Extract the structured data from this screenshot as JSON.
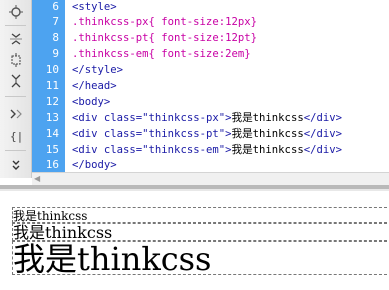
{
  "toolbar": {
    "icons": [
      "pin-icon",
      "expand-icon",
      "collapse-icon",
      "select-icon",
      "format-icon",
      "brace-icon",
      "more-icon"
    ]
  },
  "editor": {
    "lines": [
      {
        "num": "6",
        "parts": [
          {
            "t": "tag",
            "v": "<style>"
          }
        ]
      },
      {
        "num": "7",
        "parts": [
          {
            "t": "css",
            "v": ".thinkcss-px{ font-size:12px}"
          }
        ]
      },
      {
        "num": "8",
        "parts": [
          {
            "t": "css",
            "v": ".thinkcss-pt{ font-size:12pt}"
          }
        ]
      },
      {
        "num": "9",
        "parts": [
          {
            "t": "css",
            "v": ".thinkcss-em{ font-size:2em}"
          }
        ]
      },
      {
        "num": "10",
        "parts": [
          {
            "t": "tag",
            "v": "</style>"
          }
        ]
      },
      {
        "num": "11",
        "parts": [
          {
            "t": "tag",
            "v": "</head>"
          }
        ]
      },
      {
        "num": "12",
        "parts": [
          {
            "t": "tag",
            "v": "<body>"
          }
        ]
      },
      {
        "num": "13",
        "parts": [
          {
            "t": "tag",
            "v": "<div class="
          },
          {
            "t": "str",
            "v": "\"thinkcss-px\""
          },
          {
            "t": "tag",
            "v": ">"
          },
          {
            "t": "txt",
            "v": "我是thinkcss"
          },
          {
            "t": "tag",
            "v": "</div>"
          }
        ]
      },
      {
        "num": "14",
        "parts": [
          {
            "t": "tag",
            "v": "<div class="
          },
          {
            "t": "str",
            "v": "\"thinkcss-pt\""
          },
          {
            "t": "tag",
            "v": ">"
          },
          {
            "t": "txt",
            "v": "我是thinkcss"
          },
          {
            "t": "tag",
            "v": "</div>"
          }
        ]
      },
      {
        "num": "15",
        "parts": [
          {
            "t": "tag",
            "v": "<div class="
          },
          {
            "t": "str",
            "v": "\"thinkcss-em\""
          },
          {
            "t": "tag",
            "v": ">"
          },
          {
            "t": "txt",
            "v": "我是thinkcss"
          },
          {
            "t": "tag",
            "v": "</div>"
          }
        ]
      },
      {
        "num": "16",
        "parts": [
          {
            "t": "tag",
            "v": "</body>"
          }
        ]
      }
    ]
  },
  "preview": {
    "px_text": "我是thinkcss",
    "pt_text": "我是thinkcss",
    "em_text": "我是thinkcss"
  },
  "colors": {
    "gutter": "#4da3f0",
    "tag": "#1a1aa6",
    "css": "#c800a4"
  }
}
